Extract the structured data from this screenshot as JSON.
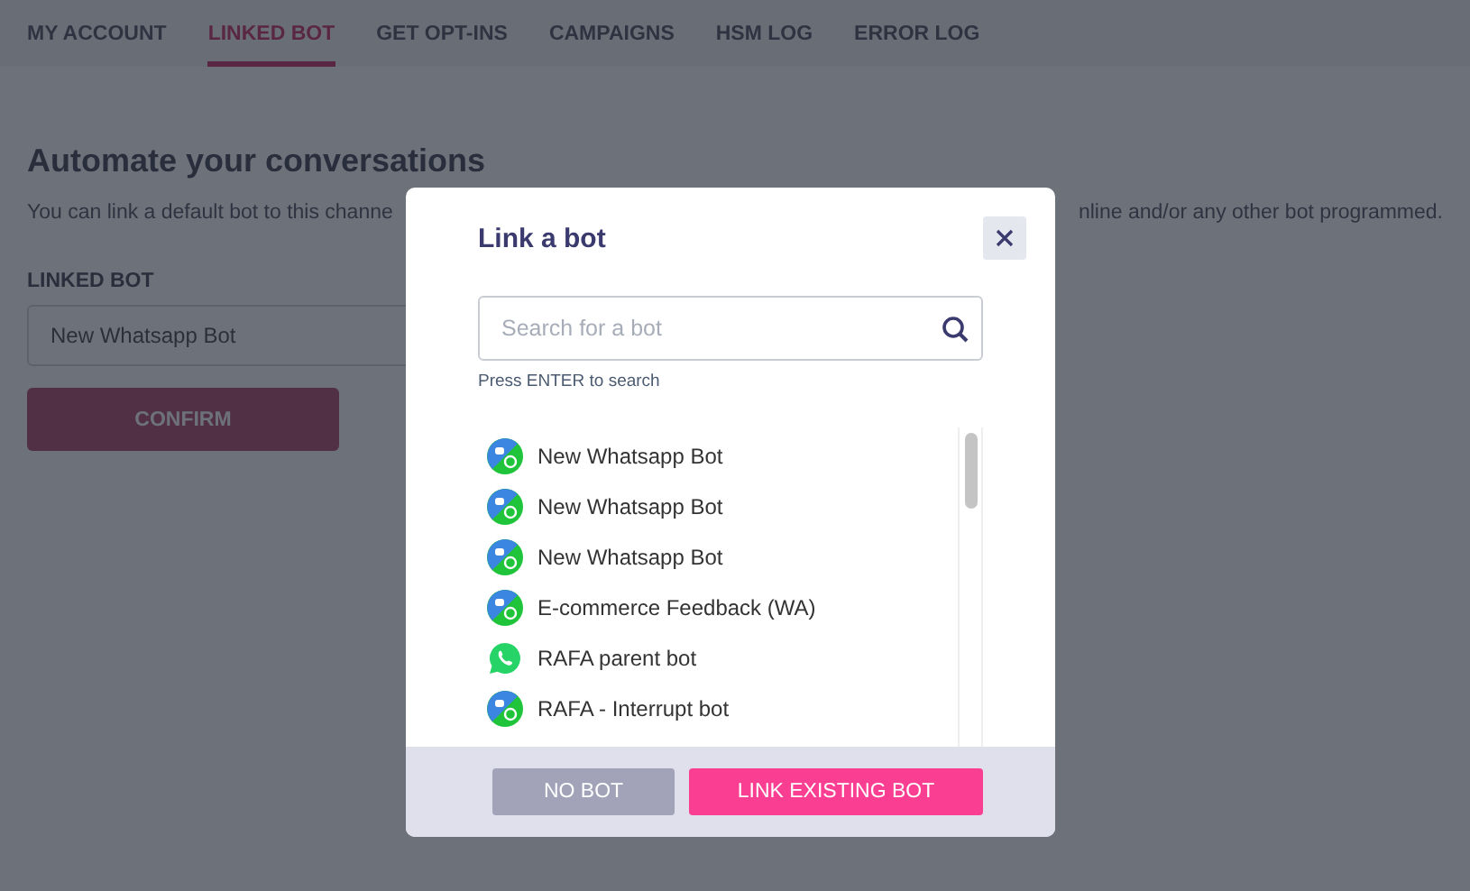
{
  "tabs": [
    {
      "label": "MY ACCOUNT",
      "selected": false
    },
    {
      "label": "LINKED BOT",
      "selected": true
    },
    {
      "label": "GET OPT-INS",
      "selected": false
    },
    {
      "label": "CAMPAIGNS",
      "selected": false
    },
    {
      "label": "HSM LOG",
      "selected": false
    },
    {
      "label": "ERROR LOG",
      "selected": false
    }
  ],
  "page": {
    "heading": "Automate your conversations",
    "description_left": "You can link a default bot to this channe",
    "description_right": "nline and/or any other bot programmed.",
    "field_label": "LINKED BOT",
    "field_value": "New Whatsapp Bot",
    "confirm_button": "CONFIRM"
  },
  "dialog": {
    "title": "Link a bot",
    "search": {
      "placeholder": "Search for a bot"
    },
    "hint": "Press ENTER to search",
    "bots": [
      {
        "name": "New Whatsapp Bot",
        "kind": "hybrid"
      },
      {
        "name": "New Whatsapp Bot",
        "kind": "hybrid"
      },
      {
        "name": "New Whatsapp Bot",
        "kind": "hybrid"
      },
      {
        "name": "E-commerce Feedback (WA)",
        "kind": "hybrid"
      },
      {
        "name": "RAFA parent bot",
        "kind": "whatsapp"
      },
      {
        "name": "RAFA - Interrupt bot",
        "kind": "hybrid"
      }
    ],
    "buttons": {
      "secondary": "NO BOT",
      "primary": "LINK EXISTING BOT"
    }
  }
}
